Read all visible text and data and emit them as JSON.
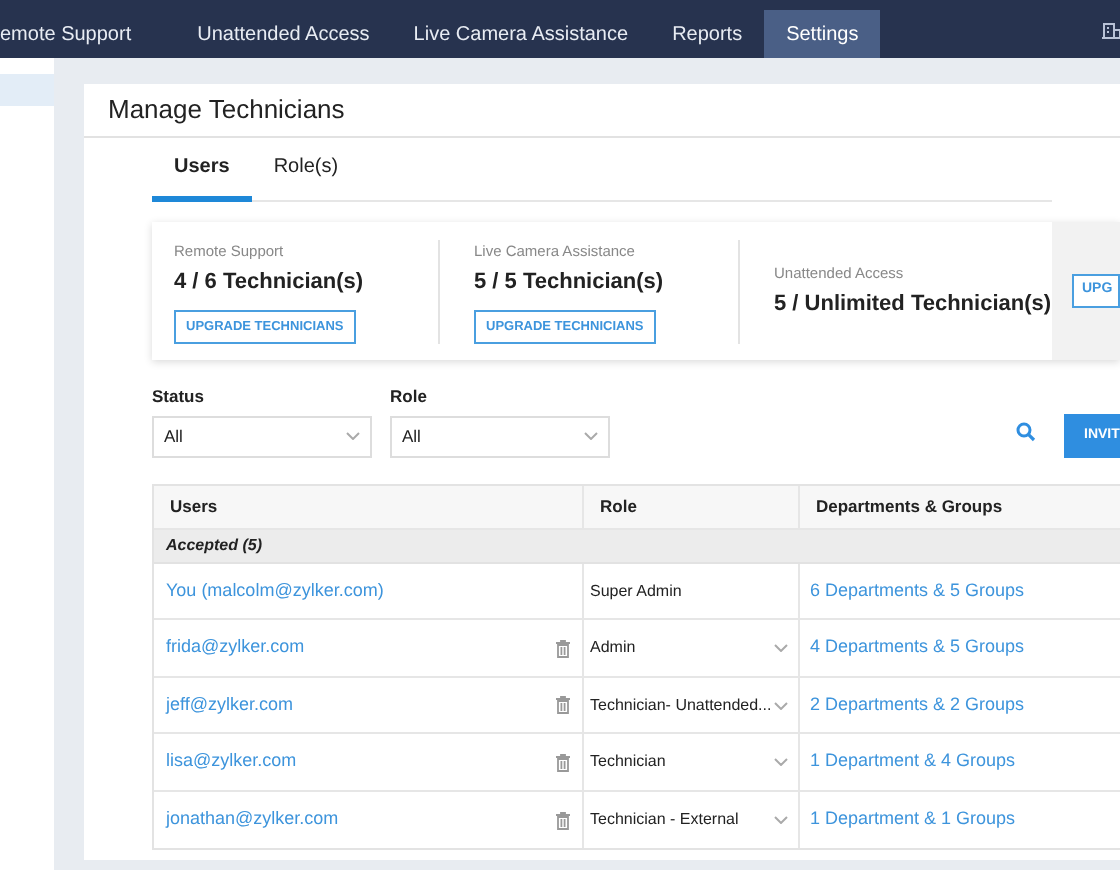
{
  "nav": {
    "items": [
      {
        "label": "emote Support",
        "selected": false
      },
      {
        "label": "Unattended Access",
        "selected": false
      },
      {
        "label": "Live Camera Assistance",
        "selected": false
      },
      {
        "label": "Reports",
        "selected": false
      },
      {
        "label": "Settings",
        "selected": true
      }
    ]
  },
  "panel": {
    "title": "Manage Technicians",
    "tabs": [
      {
        "label": "Users",
        "selected": true
      },
      {
        "label": "Role(s)",
        "selected": false
      }
    ],
    "licenses": [
      {
        "name": "Remote Support",
        "count": "4 / 6 Technician(s)",
        "button": "UPGRADE TECHNICIANS"
      },
      {
        "name": "Live Camera Assistance",
        "count": "5 / 5 Technician(s)",
        "button": "UPGRADE TECHNICIANS"
      },
      {
        "name": "Unattended Access",
        "count": "5 / Unlimited Technician(s)"
      }
    ],
    "side_button": "UPG",
    "filters": [
      {
        "label": "Status",
        "value": "All"
      },
      {
        "label": "Role",
        "value": "All"
      }
    ],
    "invite_button": "INVIT",
    "table": {
      "columns": [
        "Users",
        "Role",
        "Departments & Groups"
      ],
      "group": "Accepted (5)",
      "rows": [
        {
          "user": "You (malcolm@zylker.com)",
          "role": "Super Admin",
          "departments": "6 Departments & 5 Groups",
          "editable": false
        },
        {
          "user": "frida@zylker.com",
          "role": "Admin",
          "departments": "4 Departments & 5 Groups",
          "editable": true
        },
        {
          "user": "jeff@zylker.com",
          "role": "Technician- Unattended...",
          "departments": "2 Departments & 2 Groups",
          "editable": true
        },
        {
          "user": "lisa@zylker.com",
          "role": "Technician",
          "departments": "1 Department & 4 Groups",
          "editable": true
        },
        {
          "user": "jonathan@zylker.com",
          "role": "Technician - External",
          "departments": "1 Department & 1 Groups",
          "editable": true
        }
      ]
    }
  }
}
